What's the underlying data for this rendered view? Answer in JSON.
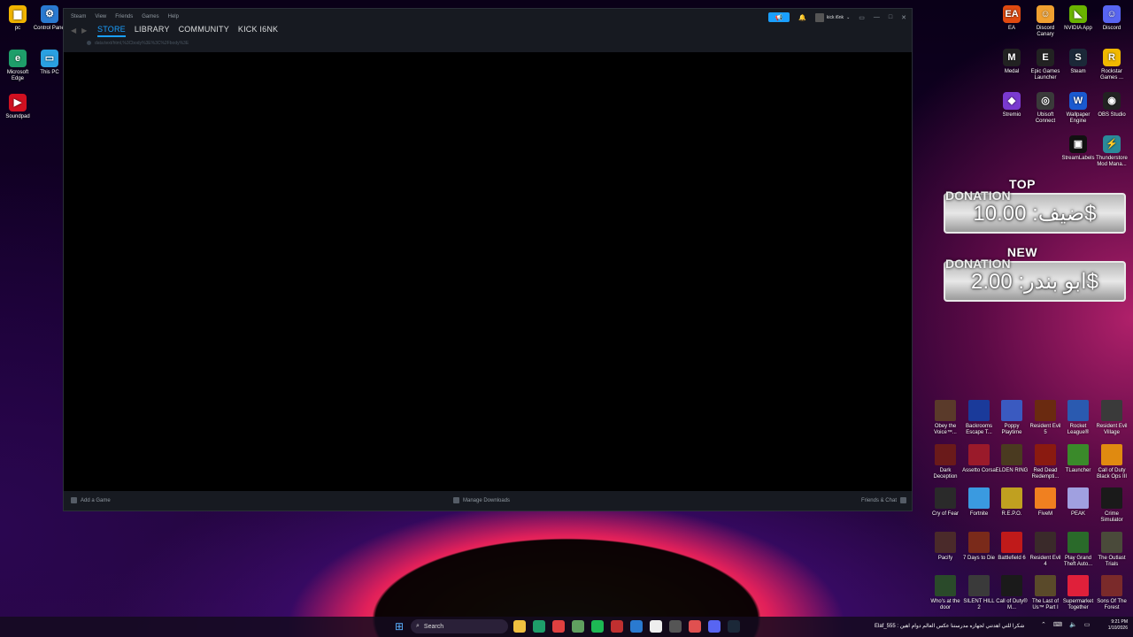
{
  "steam": {
    "menu": [
      "Steam",
      "View",
      "Friends",
      "Games",
      "Help"
    ],
    "tabs": [
      "STORE",
      "LIBRARY",
      "COMMUNITY",
      "KICK I6NK"
    ],
    "active_tab": "STORE",
    "url": "data:text/html,%3Cbody%3E%3C%2Fbody%3E",
    "username": "kick i6nk",
    "bottom": {
      "add_game": "Add a Game",
      "manage_downloads": "Manage Downloads",
      "friends_chat": "Friends & Chat"
    }
  },
  "desktop_left": [
    {
      "label": "pc",
      "color": "#f0b400",
      "glyph": "▆"
    },
    {
      "label": "Control Panel",
      "color": "#2a7ad0",
      "glyph": "⚙"
    },
    {
      "label": "Microsoft Edge",
      "color": "#1e9e6a",
      "glyph": "e"
    },
    {
      "label": "This PC",
      "color": "#2aa0e0",
      "glyph": "▭"
    },
    {
      "label": "Soundpad",
      "color": "#d01020",
      "glyph": "▶"
    }
  ],
  "desktop_right": [
    {
      "label": "EA",
      "color": "#e04a10",
      "glyph": "EA"
    },
    {
      "label": "Discord Canary",
      "color": "#f0a030",
      "glyph": "☺"
    },
    {
      "label": "NVIDIA App",
      "color": "#6ab400",
      "glyph": "◣"
    },
    {
      "label": "Discord",
      "color": "#5865f2",
      "glyph": "☺"
    },
    {
      "label": "Medal",
      "color": "#222",
      "glyph": "M"
    },
    {
      "label": "Epic Games Launcher",
      "color": "#222",
      "glyph": "E"
    },
    {
      "label": "Steam",
      "color": "#1b2838",
      "glyph": "S"
    },
    {
      "label": "Rockstar Games ...",
      "color": "#f0b800",
      "glyph": "R"
    },
    {
      "label": "Stremio",
      "color": "#7a3ad0",
      "glyph": "◆"
    },
    {
      "label": "Ubisoft Connect",
      "color": "#3a3a3a",
      "glyph": "◎"
    },
    {
      "label": "Wallpaper Engine",
      "color": "#1a5ad0",
      "glyph": "W"
    },
    {
      "label": "OBS Studio",
      "color": "#222",
      "glyph": "◉"
    },
    {
      "label": "StreamLabels",
      "color": "#111",
      "glyph": "▣"
    },
    {
      "label": "Thunderstore Mod Mana...",
      "color": "#2a8a9a",
      "glyph": "⚡"
    }
  ],
  "games": [
    {
      "label": "Obey the Voice™...",
      "color": "#5a3a2a"
    },
    {
      "label": "Backrooms Escape T...",
      "color": "#1a3a9a"
    },
    {
      "label": "Poppy Playtime",
      "color": "#3a5ac0"
    },
    {
      "label": "Resident Evil 5",
      "color": "#6a2a10"
    },
    {
      "label": "Rocket League®",
      "color": "#2a5ab0"
    },
    {
      "label": "Resident Evil Village",
      "color": "#3a3a3a"
    },
    {
      "label": "Dark Deception",
      "color": "#6a1a1a"
    },
    {
      "label": "Assetto Corsa",
      "color": "#9a1a2a"
    },
    {
      "label": "ELDEN RING",
      "color": "#4a3a20"
    },
    {
      "label": "Red Dead Redempti...",
      "color": "#8a1a10"
    },
    {
      "label": "TLauncher",
      "color": "#3a8a2a"
    },
    {
      "label": "Call of Duty Black Ops III",
      "color": "#e08a10"
    },
    {
      "label": "Cry of Fear",
      "color": "#2a2a2a"
    },
    {
      "label": "Fortnite",
      "color": "#3a9ae0"
    },
    {
      "label": "R.E.P.O.",
      "color": "#c0a020"
    },
    {
      "label": "FiveM",
      "color": "#f08020"
    },
    {
      "label": "PEAK",
      "color": "#a0a0e0"
    },
    {
      "label": "Crime Simulator",
      "color": "#1a1a1a"
    },
    {
      "label": "Pacify",
      "color": "#4a2a2a"
    },
    {
      "label": "7 Days to Die",
      "color": "#7a2a1a"
    },
    {
      "label": "Battlefield 6",
      "color": "#c01a1a"
    },
    {
      "label": "Resident Evil 4",
      "color": "#3a2a2a"
    },
    {
      "label": "Play Grand Theft Auto...",
      "color": "#2a6a2a"
    },
    {
      "label": "The Outlast Trials",
      "color": "#4a4a3a"
    },
    {
      "label": "Who's at the door",
      "color": "#2a4a2a"
    },
    {
      "label": "SILENT HILL 2",
      "color": "#3a3a3a"
    },
    {
      "label": "Call of Duty® M...",
      "color": "#1a1a1a"
    },
    {
      "label": "The Last of Us™ Part I",
      "color": "#5a4a2a"
    },
    {
      "label": "Supermarket Together",
      "color": "#e0203a"
    },
    {
      "label": "Sons Of The Forest",
      "color": "#7a2a2a"
    }
  ],
  "donations": {
    "top": {
      "label1": "TOP",
      "label2": "DONATION",
      "value": "ضيف: 10.00$"
    },
    "new": {
      "label1": "NEW",
      "label2": "DONATION",
      "value": "ابو بندر: 2.00$"
    }
  },
  "taskbar": {
    "search": "Search",
    "news": "Elaf_555 : شكرا للتي اهدتني لجهازه مدرستنا عكس العالم دوام اهين",
    "time": "9:21 PM",
    "date": "1/10/2026"
  }
}
